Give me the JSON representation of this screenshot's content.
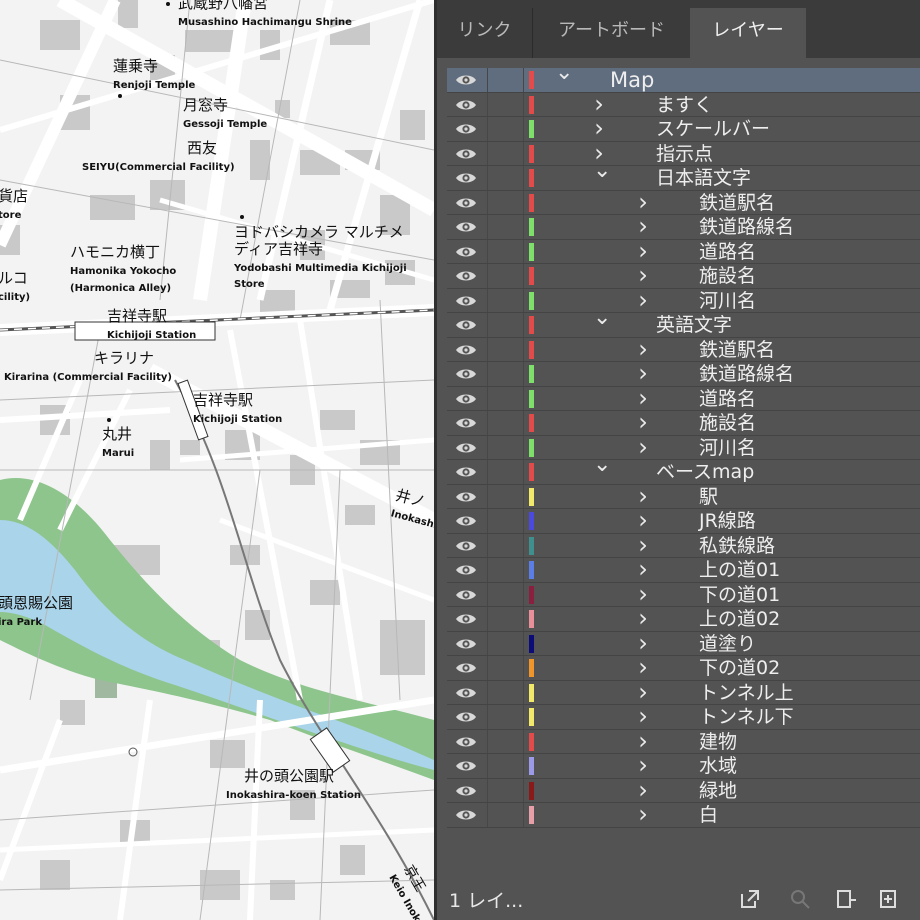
{
  "map": {
    "labels": [
      {
        "jp": "武蔵野八幡宮",
        "en": "Musashino Hachimangu Shrine"
      },
      {
        "jp": "蓮乗寺",
        "en": "Renjoji Temple"
      },
      {
        "jp": "月窓寺",
        "en": "Gessoji Temple"
      },
      {
        "jp": "西友",
        "en": "SEIYU(Commercial Facility)"
      },
      {
        "jp": "ヨドバシカメラ マルチメディア吉祥寺",
        "en": "Yodobashi Multimedia Kichijoji Store"
      },
      {
        "jp": "ハモニカ横丁",
        "en": "Hamonika Yokocho (Harmonica Alley)"
      },
      {
        "jp": "吉祥寺駅",
        "en": "Kichijoji Station"
      },
      {
        "jp": "キラリナ",
        "en": "Kirarina (Commercial Facility)"
      },
      {
        "jp": "吉祥寺駅",
        "en": "Kichijoji Station"
      },
      {
        "jp": "丸井",
        "en": "Marui"
      },
      {
        "jp": "頭恩賜公園",
        "en": "ira Park"
      },
      {
        "jp": "井の頭公園駅",
        "en": "Inokashira-koen Station"
      },
      {
        "jp": "井ノ",
        "en": "Inokashi"
      },
      {
        "jp": "京王",
        "en": "Keio Inoka"
      },
      {
        "jp": "貨店",
        "en": "tore"
      },
      {
        "jp": "ルコ",
        "en": "cility)"
      }
    ]
  },
  "panel": {
    "tabs": [
      {
        "label": "リンク"
      },
      {
        "label": "アートボード"
      },
      {
        "label": "レイヤー",
        "active": true
      }
    ],
    "layers": [
      {
        "name": "Map",
        "color": "#e34b4b",
        "level": 0,
        "expanded": true,
        "selected": true
      },
      {
        "name": "ますく",
        "color": "#e34b4b",
        "level": 1,
        "expanded": false
      },
      {
        "name": "スケールバー",
        "color": "#7ee06a",
        "level": 1,
        "expanded": false
      },
      {
        "name": "指示点",
        "color": "#e34b4b",
        "level": 1,
        "expanded": false
      },
      {
        "name": "日本語文字",
        "color": "#e34b4b",
        "level": 1,
        "expanded": true
      },
      {
        "name": "鉄道駅名",
        "color": "#e34b4b",
        "level": 2,
        "expanded": false
      },
      {
        "name": "鉄道路線名",
        "color": "#7ee06a",
        "level": 2,
        "expanded": false
      },
      {
        "name": "道路名",
        "color": "#7ee06a",
        "level": 2,
        "expanded": false
      },
      {
        "name": "施設名",
        "color": "#e34b4b",
        "level": 2,
        "expanded": false
      },
      {
        "name": "河川名",
        "color": "#7ee06a",
        "level": 2,
        "expanded": false
      },
      {
        "name": "英語文字",
        "color": "#e34b4b",
        "level": 1,
        "expanded": true
      },
      {
        "name": "鉄道駅名",
        "color": "#e34b4b",
        "level": 2,
        "expanded": false
      },
      {
        "name": "鉄道路線名",
        "color": "#7ee06a",
        "level": 2,
        "expanded": false
      },
      {
        "name": "道路名",
        "color": "#7ee06a",
        "level": 2,
        "expanded": false
      },
      {
        "name": "施設名",
        "color": "#e34b4b",
        "level": 2,
        "expanded": false
      },
      {
        "name": "河川名",
        "color": "#7ee06a",
        "level": 2,
        "expanded": false
      },
      {
        "name": "ベースmap",
        "color": "#e34b4b",
        "level": 1,
        "expanded": true
      },
      {
        "name": "駅",
        "color": "#f2e86a",
        "level": 2,
        "expanded": false
      },
      {
        "name": "JR線路",
        "color": "#4a4adf",
        "level": 2,
        "expanded": false
      },
      {
        "name": "私鉄線路",
        "color": "#3f8f8f",
        "level": 2,
        "expanded": false
      },
      {
        "name": "上の道01",
        "color": "#5a7ee6",
        "level": 2,
        "expanded": false
      },
      {
        "name": "下の道01",
        "color": "#8a1f3f",
        "level": 2,
        "expanded": false
      },
      {
        "name": "上の道02",
        "color": "#e88f9a",
        "level": 2,
        "expanded": false
      },
      {
        "name": "道塗り",
        "color": "#0b0b7a",
        "level": 2,
        "expanded": false
      },
      {
        "name": "下の道02",
        "color": "#f0952a",
        "level": 2,
        "expanded": false
      },
      {
        "name": "トンネル上",
        "color": "#f2e86a",
        "level": 2,
        "expanded": false
      },
      {
        "name": "トンネル下",
        "color": "#f2e86a",
        "level": 2,
        "expanded": false
      },
      {
        "name": "建物",
        "color": "#e34b4b",
        "level": 2,
        "expanded": false
      },
      {
        "name": "水域",
        "color": "#9a9ae8",
        "level": 2,
        "expanded": false
      },
      {
        "name": "緑地",
        "color": "#8a1a1a",
        "level": 2,
        "expanded": false
      },
      {
        "name": "白",
        "color": "#e8a0a8",
        "level": 2,
        "expanded": false
      }
    ],
    "footer": {
      "count_label": "1 レイ...",
      "icons": [
        "export-icon",
        "search-icon",
        "new-sublayer-icon",
        "new-layer-icon"
      ]
    }
  }
}
